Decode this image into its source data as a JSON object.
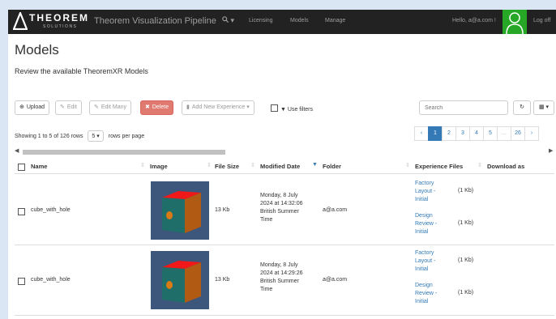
{
  "navbar": {
    "brand_word": "THEOREM",
    "brand_sub": "SOLUTIONS",
    "app_title": "Theorem Visualization Pipeline",
    "search_caret": "▾",
    "links": [
      "Licensing",
      "Models",
      "Manage"
    ],
    "greeting": "Hello, a@a.com !",
    "logoff": "Log off"
  },
  "page": {
    "title": "Models",
    "subtitle": "Review the available TheoremXR Models"
  },
  "toolbar": {
    "upload": "Upload",
    "edit": "Edit",
    "edit_many": "Edit Many",
    "delete": "Delete",
    "add_experience": "Add New Experience",
    "use_filters": "Use filters",
    "search_placeholder": "Search"
  },
  "pagination": {
    "showing": "Showing 1 to 5 of 126 rows",
    "page_size": "5",
    "per_page": "rows per page",
    "prev": "‹",
    "pages": [
      "1",
      "2",
      "3",
      "4",
      "5",
      "...",
      "26"
    ],
    "next": "›",
    "active_page": "1"
  },
  "table": {
    "columns": [
      "Name",
      "Image",
      "File Size",
      "Modified Date",
      "Folder",
      "Experience Files",
      "Download as"
    ],
    "rows": [
      {
        "name": "cube_with_hole",
        "file_size": "13 Kb",
        "modified": "Monday, 8 July 2024 at 14:32:06 British Summer Time",
        "folder": "a@a.com",
        "experiences": [
          {
            "label": "Factory Layout - Initial",
            "size": "(1 Kb)"
          },
          {
            "label": "Design Review - Initial",
            "size": "(1 Kb)"
          }
        ]
      },
      {
        "name": "cube_with_hole",
        "file_size": "13 Kb",
        "modified": "Monday, 8 July 2024 at 14:29:26 British Summer Time",
        "folder": "a@a.com",
        "experiences": [
          {
            "label": "Factory Layout - Initial",
            "size": "(1 Kb)"
          },
          {
            "label": "Design Review - Initial",
            "size": "(1 Kb)"
          }
        ]
      }
    ]
  },
  "colors": {
    "navbar_bg": "#222222",
    "accent": "#337ab7",
    "danger": "#e0796f",
    "avatar_bg": "#26a826"
  }
}
